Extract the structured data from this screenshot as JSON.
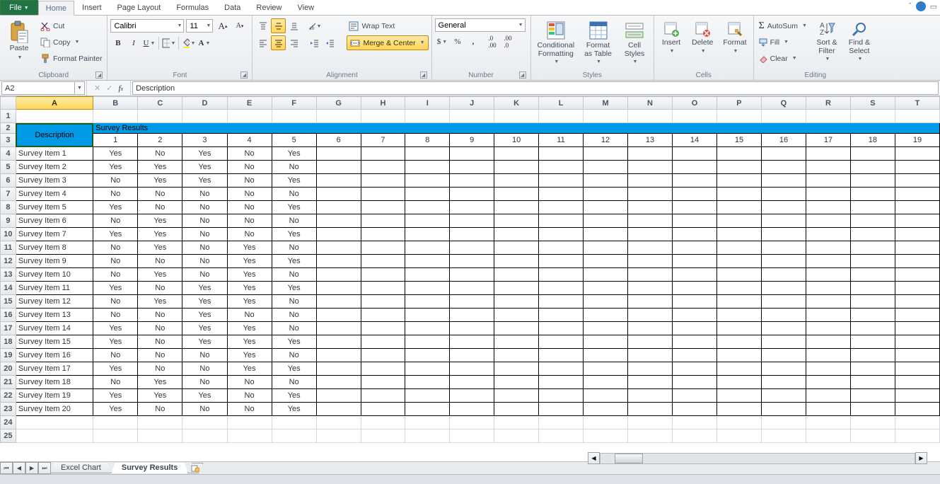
{
  "tabs": {
    "file": "File",
    "list": [
      "Home",
      "Insert",
      "Page Layout",
      "Formulas",
      "Data",
      "Review",
      "View"
    ],
    "active": "Home"
  },
  "ribbon": {
    "clipboard": {
      "title": "Clipboard",
      "paste": "Paste",
      "cut": "Cut",
      "copy": "Copy",
      "fmt": "Format Painter"
    },
    "font": {
      "title": "Font",
      "name": "Calibri",
      "size": "11"
    },
    "alignment": {
      "title": "Alignment",
      "wrap": "Wrap Text",
      "merge": "Merge & Center"
    },
    "number": {
      "title": "Number",
      "format": "General"
    },
    "styles": {
      "title": "Styles",
      "cond": "Conditional\nFormatting",
      "fmtTable": "Format\nas Table",
      "cell": "Cell\nStyles"
    },
    "cells": {
      "title": "Cells",
      "insert": "Insert",
      "delete": "Delete",
      "format": "Format"
    },
    "editing": {
      "title": "Editing",
      "autosum": "AutoSum",
      "fill": "Fill",
      "clear": "Clear",
      "sort": "Sort &\nFilter",
      "find": "Find &\nSelect"
    }
  },
  "formula_bar": {
    "name_box": "A2",
    "fx": "Description"
  },
  "columns": [
    "A",
    "B",
    "C",
    "D",
    "E",
    "F",
    "G",
    "H",
    "I",
    "J",
    "K",
    "L",
    "M",
    "N",
    "O",
    "P",
    "Q",
    "R",
    "S",
    "T"
  ],
  "colA_width": 110,
  "header": {
    "desc": "Description",
    "survey": "Survey Results",
    "nums": [
      "1",
      "2",
      "3",
      "4",
      "5",
      "6",
      "7",
      "8",
      "9",
      "10",
      "11",
      "12",
      "13",
      "14",
      "15",
      "16",
      "17",
      "18",
      "19"
    ]
  },
  "rows": [
    {
      "a": "Survey Item 1",
      "v": [
        "Yes",
        "No",
        "Yes",
        "No",
        "Yes"
      ]
    },
    {
      "a": "Survey Item 2",
      "v": [
        "Yes",
        "Yes",
        "Yes",
        "No",
        "No"
      ]
    },
    {
      "a": "Survey Item 3",
      "v": [
        "No",
        "Yes",
        "Yes",
        "No",
        "Yes"
      ]
    },
    {
      "a": "Survey Item 4",
      "v": [
        "No",
        "No",
        "No",
        "No",
        "No"
      ]
    },
    {
      "a": "Survey Item 5",
      "v": [
        "Yes",
        "No",
        "No",
        "No",
        "Yes"
      ]
    },
    {
      "a": "Survey Item 6",
      "v": [
        "No",
        "Yes",
        "No",
        "No",
        "No"
      ]
    },
    {
      "a": "Survey Item 7",
      "v": [
        "Yes",
        "Yes",
        "No",
        "No",
        "Yes"
      ]
    },
    {
      "a": "Survey Item 8",
      "v": [
        "No",
        "Yes",
        "No",
        "Yes",
        "No"
      ]
    },
    {
      "a": "Survey Item 9",
      "v": [
        "No",
        "No",
        "No",
        "Yes",
        "Yes"
      ]
    },
    {
      "a": "Survey Item 10",
      "v": [
        "No",
        "Yes",
        "No",
        "Yes",
        "No"
      ]
    },
    {
      "a": "Survey Item 11",
      "v": [
        "Yes",
        "No",
        "Yes",
        "Yes",
        "Yes"
      ]
    },
    {
      "a": "Survey Item 12",
      "v": [
        "No",
        "Yes",
        "Yes",
        "Yes",
        "No"
      ]
    },
    {
      "a": "Survey Item 13",
      "v": [
        "No",
        "No",
        "Yes",
        "No",
        "No"
      ]
    },
    {
      "a": "Survey Item 14",
      "v": [
        "Yes",
        "No",
        "Yes",
        "Yes",
        "No"
      ]
    },
    {
      "a": "Survey Item 15",
      "v": [
        "Yes",
        "No",
        "Yes",
        "Yes",
        "Yes"
      ]
    },
    {
      "a": "Survey Item 16",
      "v": [
        "No",
        "No",
        "No",
        "Yes",
        "No"
      ]
    },
    {
      "a": "Survey Item 17",
      "v": [
        "Yes",
        "No",
        "No",
        "Yes",
        "Yes"
      ]
    },
    {
      "a": "Survey Item 18",
      "v": [
        "No",
        "Yes",
        "No",
        "No",
        "No"
      ]
    },
    {
      "a": "Survey Item 19",
      "v": [
        "Yes",
        "Yes",
        "Yes",
        "No",
        "Yes"
      ]
    },
    {
      "a": "Survey Item 20",
      "v": [
        "Yes",
        "No",
        "No",
        "No",
        "Yes"
      ]
    }
  ],
  "sheets": {
    "list": [
      "Excel Chart",
      "Survey Results"
    ],
    "active": "Survey Results"
  }
}
